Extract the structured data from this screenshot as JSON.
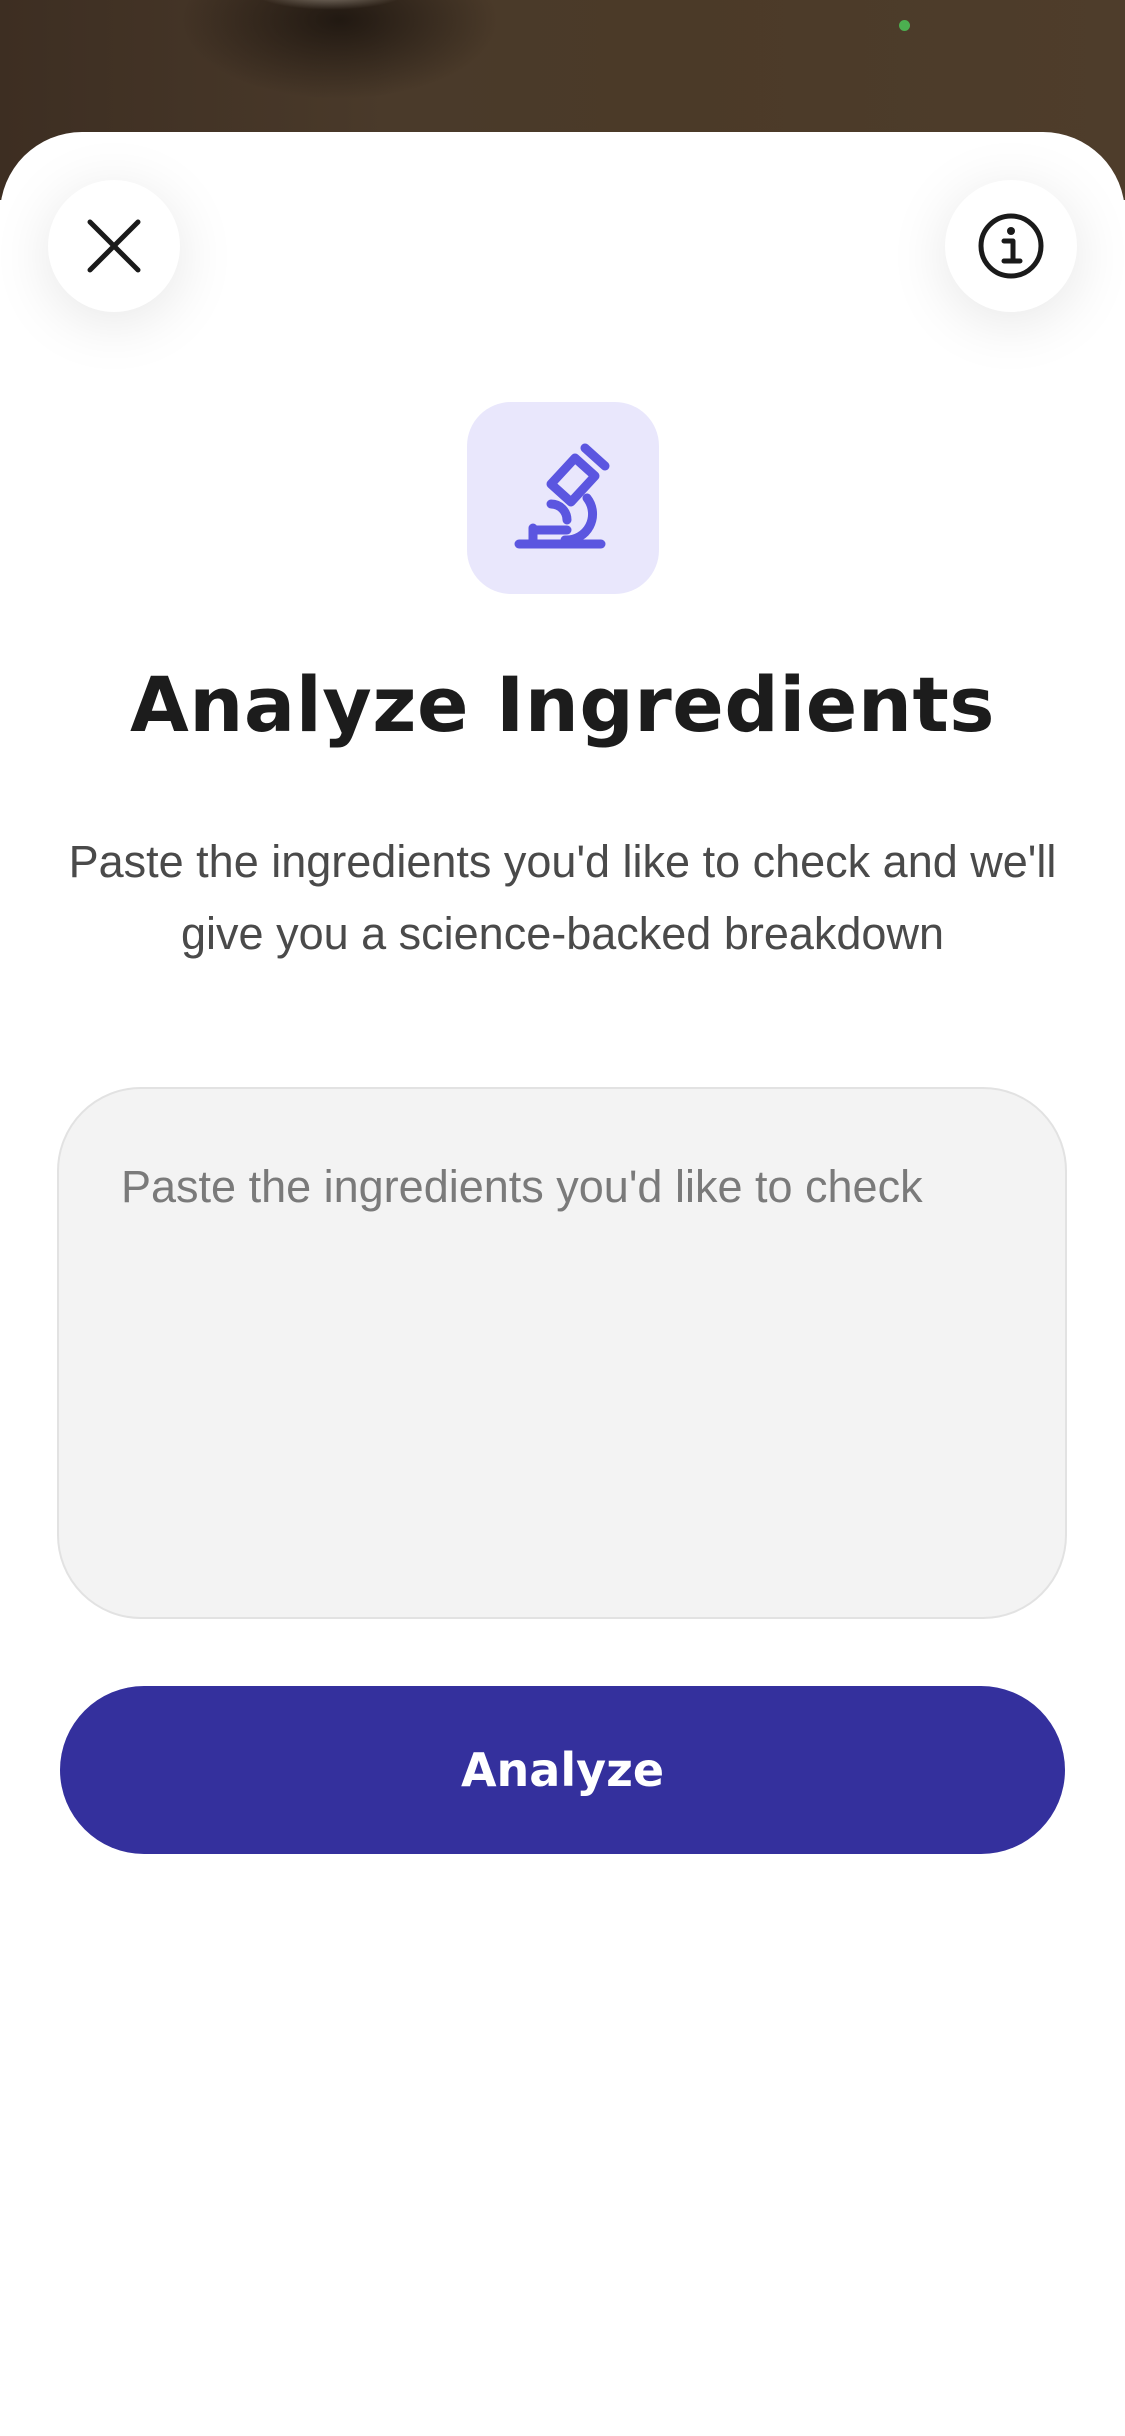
{
  "header": {
    "close_icon": "close-icon",
    "info_icon": "info-icon"
  },
  "hero": {
    "icon": "microscope-icon",
    "title": "Analyze Ingredients",
    "subtitle": "Paste the ingredients you'd like to check and we'll give you a science-backed breakdown"
  },
  "form": {
    "ingredients_placeholder": "Paste the ingredients you'd like to check",
    "ingredients_value": "",
    "submit_label": "Analyze"
  },
  "colors": {
    "accent": "#34309d",
    "icon_tint": "#5b56e0",
    "icon_tile": "#e9e7fc"
  }
}
